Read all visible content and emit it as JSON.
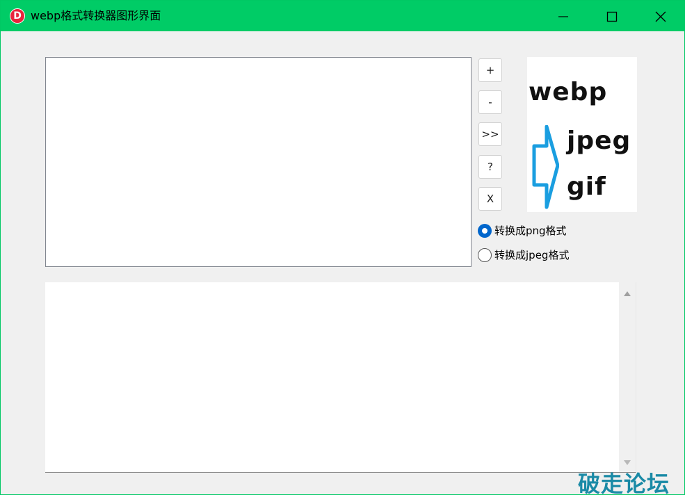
{
  "window": {
    "title": "webp格式转换器图形界面",
    "app_icon_letter": "D",
    "titlebar_color": "#00cc66",
    "controls": [
      "minimize-icon",
      "maximize-icon",
      "close-icon"
    ]
  },
  "side_buttons": {
    "add_label": "+",
    "remove_label": "-",
    "convert_label": ">>",
    "help_label": "?",
    "exit_label": "X"
  },
  "logo": {
    "word_top": "webp",
    "word_mid": "jpeg",
    "word_bottom": "gif",
    "arrow_icon": "right-arrow-icon",
    "arrow_color": "#1a9ee0"
  },
  "radio_options": {
    "png_label": "转换成png格式",
    "png_selected": true,
    "jpeg_label": "转换成jpeg格式",
    "jpeg_selected": false
  },
  "file_list": {
    "items": []
  },
  "log": {
    "text": ""
  },
  "watermark": {
    "text": "破走论坛"
  },
  "colors": {
    "accent": "#0066cc",
    "window_bg": "#f0f0f0"
  }
}
